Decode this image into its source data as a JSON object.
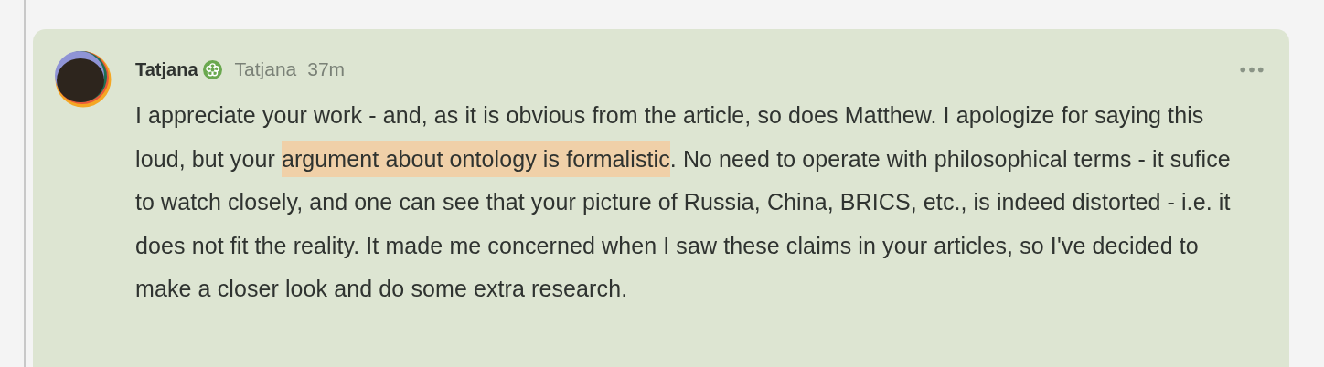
{
  "comment": {
    "author": "Tatjana",
    "verified": true,
    "handle": "Tatjana",
    "time": "37m",
    "body": [
      {
        "text": "I appreciate your work - and, as it is obvious from the article, so does Matthew. I apologize for saying this loud, but your ",
        "highlighted": false
      },
      {
        "text": "argument about ontology is formalistic",
        "highlighted": true
      },
      {
        "text": ". No need to operate with philosophical terms - it sufice to watch closely, and one can see that your picture of Russia, China, BRICS, etc., is indeed distorted - i.e. it does not fit the reality. It made me concerned when I saw these claims in your articles, so I've decided to make a closer look and do some extra research.",
        "highlighted": false
      }
    ]
  }
}
